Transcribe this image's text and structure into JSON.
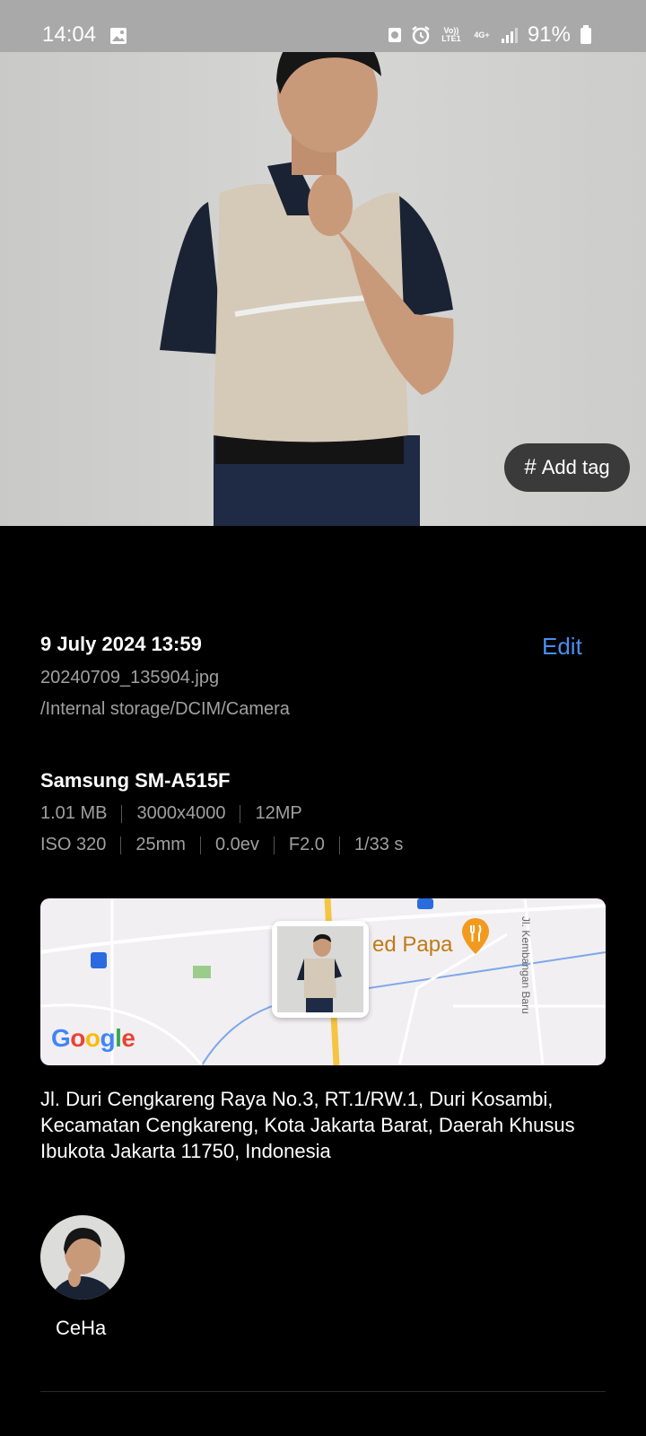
{
  "status_bar": {
    "time": "14:04",
    "network_volte": "Vo)) LTE1",
    "network_4g": "4G+",
    "battery": "91%",
    "icons": [
      "gallery-icon",
      "storage-icon",
      "alarm-icon",
      "volte-icon",
      "4g-icon",
      "signal-icon",
      "battery-icon"
    ]
  },
  "photo": {
    "add_tag_label": "Add tag",
    "add_tag_icon": "hash-icon"
  },
  "details": {
    "date": "9 July 2024 13:59",
    "edit_label": "Edit",
    "filename": "20240709_135904.jpg",
    "path": "/Internal storage/DCIM/Camera",
    "device": "Samsung SM-A515F",
    "specs_row1": [
      "1.01 MB",
      "3000x4000",
      "12MP"
    ],
    "specs_row2": [
      "ISO 320",
      "25mm",
      "0.0ev",
      "F2.0",
      "1/33 s"
    ]
  },
  "map": {
    "place_label": "ed Papa",
    "road_label": "Jl. Kembangan Baru",
    "google_logo": "Google"
  },
  "address": "Jl. Duri Cengkareng Raya No.3, RT.1/RW.1, Duri Kosambi, Kecamatan Cengkareng, Kota Jakarta Barat, Daerah Khusus Ibukota Jakarta 11750, Indonesia",
  "people": [
    {
      "name": "CeHa"
    }
  ],
  "colors": {
    "accent": "#4b8ef2",
    "secondary_text": "#a0a0a0",
    "background": "#000000",
    "status_bar": "#a9a9a9"
  }
}
